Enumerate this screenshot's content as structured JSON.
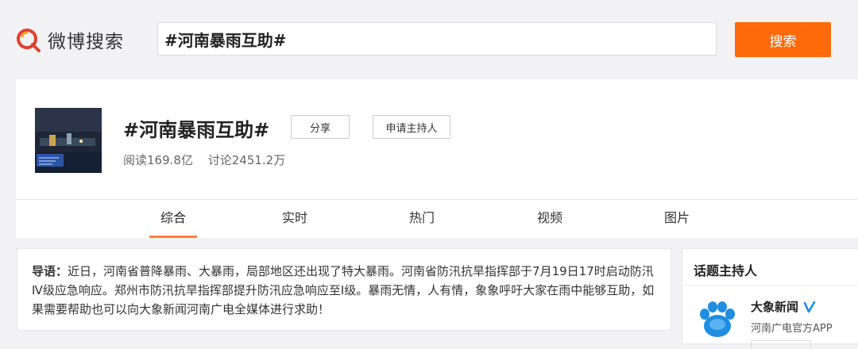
{
  "header": {
    "logo_text": "微博搜索",
    "search_value": "#河南暴雨互助#",
    "search_button": "搜索"
  },
  "topic": {
    "title": "#河南暴雨互助#",
    "share_label": "分享",
    "apply_host_label": "申请主持人",
    "reads": "阅读169.8亿",
    "discussions": "讨论2451.2万"
  },
  "tabs": [
    {
      "label": "综合",
      "active": true
    },
    {
      "label": "实时",
      "active": false
    },
    {
      "label": "热门",
      "active": false
    },
    {
      "label": "视频",
      "active": false
    },
    {
      "label": "图片",
      "active": false
    }
  ],
  "guide": {
    "label": "导语：",
    "text": "近日，河南省普降暴雨、大暴雨，局部地区还出现了特大暴雨。河南省防汛抗旱指挥部于7月19日17时启动防汛Ⅳ级应急响应。郑州市防汛抗旱指挥部提升防汛应急响应至Ⅰ级。暴雨无情，人有情，象象呼吁大家在雨中能够互助，如果需要帮助也可以向大象新闻河南广电全媒体进行求助！"
  },
  "host_panel": {
    "title": "话题主持人",
    "name": "大象新闻",
    "description": "河南广电官方APP"
  },
  "colors": {
    "accent": "#ff6a0a",
    "tab_underline": "#ff8140",
    "verify": "#1a8fe3"
  }
}
